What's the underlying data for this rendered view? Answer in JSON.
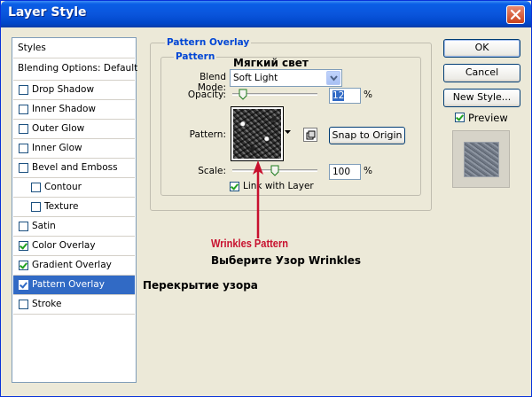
{
  "window": {
    "title": "Layer Style"
  },
  "styles_list": {
    "items": [
      {
        "label": "Styles",
        "header": true
      },
      {
        "label": "Blending Options: Default",
        "header": true
      },
      {
        "label": "Drop Shadow",
        "checked": false
      },
      {
        "label": "Inner Shadow",
        "checked": false
      },
      {
        "label": "Outer Glow",
        "checked": false
      },
      {
        "label": "Inner Glow",
        "checked": false
      },
      {
        "label": "Bevel and Emboss",
        "checked": false
      },
      {
        "label": "Contour",
        "checked": false,
        "indent": true
      },
      {
        "label": "Texture",
        "checked": false,
        "indent": true
      },
      {
        "label": "Satin",
        "checked": false
      },
      {
        "label": "Color Overlay",
        "checked": true
      },
      {
        "label": "Gradient Overlay",
        "checked": true
      },
      {
        "label": "Pattern Overlay",
        "checked": true,
        "selected": true
      },
      {
        "label": "Stroke",
        "checked": false
      }
    ]
  },
  "panel": {
    "group_title": "Pattern Overlay",
    "subgroup_title": "Pattern",
    "blend_mode_label": "Blend Mode:",
    "blend_mode_value": "Soft Light",
    "opacity_label": "Opacity:",
    "opacity_value": "12",
    "opacity_fraction": 0.12,
    "pattern_label": "Pattern:",
    "snap_button": "Snap to Origin",
    "scale_label": "Scale:",
    "scale_value": "100",
    "scale_fraction": 0.5,
    "percent": "%",
    "link_label": "Link with Layer",
    "link_checked": true
  },
  "buttons": {
    "ok": "OK",
    "cancel": "Cancel",
    "new_style": "New Style..."
  },
  "preview": {
    "label": "Preview",
    "checked": true
  },
  "annotations": {
    "blend_ru": "Мягкий свет",
    "pattern_name": "Wrinkles Pattern",
    "pattern_ru": "Выберите Узор Wrinkles",
    "overlay_ru": "Перекрытие узора"
  },
  "colors": {
    "annotation_red": "#c8102e",
    "selection": "#316ac5",
    "accent_blue": "#0046d5"
  }
}
